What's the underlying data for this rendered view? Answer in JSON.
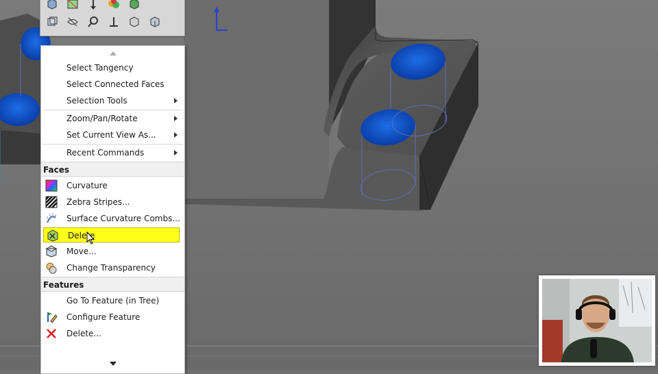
{
  "toolbar": {
    "row1_icons": [
      "view-orientation-icon",
      "display-style-icon",
      "section-view-icon",
      "appearance-icon",
      "scene-icon"
    ],
    "row2_icons": [
      "previous-view-icon",
      "hide-show-icon",
      "zoom-to-area-icon",
      "normal-to-icon",
      "isometric-view-icon",
      "view-cube-icon"
    ]
  },
  "menu": {
    "top_items": [
      {
        "label": "Select Tangency",
        "has_submenu": false
      },
      {
        "label": "Select Connected Faces",
        "has_submenu": false
      },
      {
        "label": "Selection Tools",
        "has_submenu": true
      },
      {
        "label": "Zoom/Pan/Rotate",
        "has_submenu": true
      },
      {
        "label": "Set Current View As...",
        "has_submenu": true
      },
      {
        "label": "Recent Commands",
        "has_submenu": true
      }
    ],
    "faces_header": "Faces",
    "faces_items": [
      {
        "label": "Curvature",
        "icon": "curvature-icon"
      },
      {
        "label": "Zebra Stripes...",
        "icon": "zebra-stripes-icon"
      },
      {
        "label": "Surface Curvature Combs...",
        "icon": "curvature-combs-icon"
      },
      {
        "label": "Delete",
        "icon": "delete-face-icon",
        "highlighted": true
      },
      {
        "label": "Move...",
        "icon": "move-face-icon"
      },
      {
        "label": "Change Transparency",
        "icon": "transparency-icon"
      }
    ],
    "features_header": "Features",
    "features_items": [
      {
        "label": "Go To Feature (in Tree)",
        "icon": ""
      },
      {
        "label": "Configure Feature",
        "icon": "configure-feature-icon"
      },
      {
        "label": "Delete...",
        "icon": "delete-x-icon"
      }
    ]
  },
  "colors": {
    "highlight": "#ffff1a",
    "hole_face": "#0a4fc8",
    "part_gray": "#4a4a4a",
    "background": "#6f6f6f"
  }
}
